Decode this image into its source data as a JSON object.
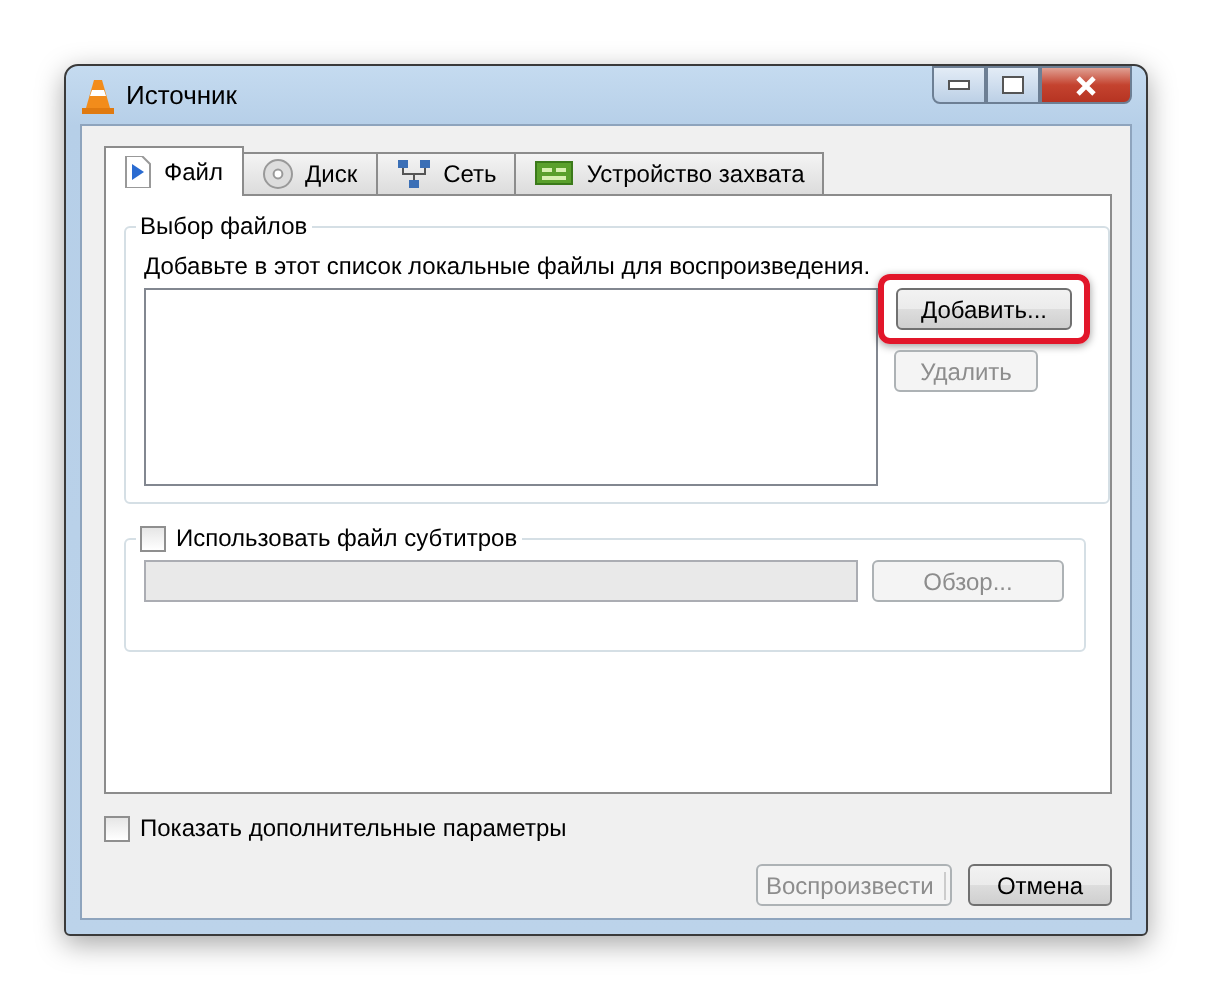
{
  "window": {
    "title": "Источник"
  },
  "tabs": [
    {
      "label": "Файл",
      "selected": true
    },
    {
      "label": "Диск",
      "selected": false
    },
    {
      "label": "Сеть",
      "selected": false
    },
    {
      "label": "Устройство захвата",
      "selected": false
    }
  ],
  "file_selection": {
    "title": "Выбор файлов",
    "hint": "Добавьте в этот список локальные файлы для воспроизведения.",
    "add_button": {
      "label": "Добавить...",
      "highlighted": true
    },
    "remove_button": {
      "label": "Удалить",
      "disabled": true
    }
  },
  "subtitles": {
    "label": "Использовать файл субтитров",
    "checked": false,
    "browse_button": {
      "label": "Обзор...",
      "disabled": true
    }
  },
  "show_more": {
    "label": "Показать дополнительные параметры",
    "checked": false
  },
  "play_button": {
    "label": "Воспроизвести",
    "disabled": true
  },
  "cancel_button": {
    "label": "Отмена"
  }
}
